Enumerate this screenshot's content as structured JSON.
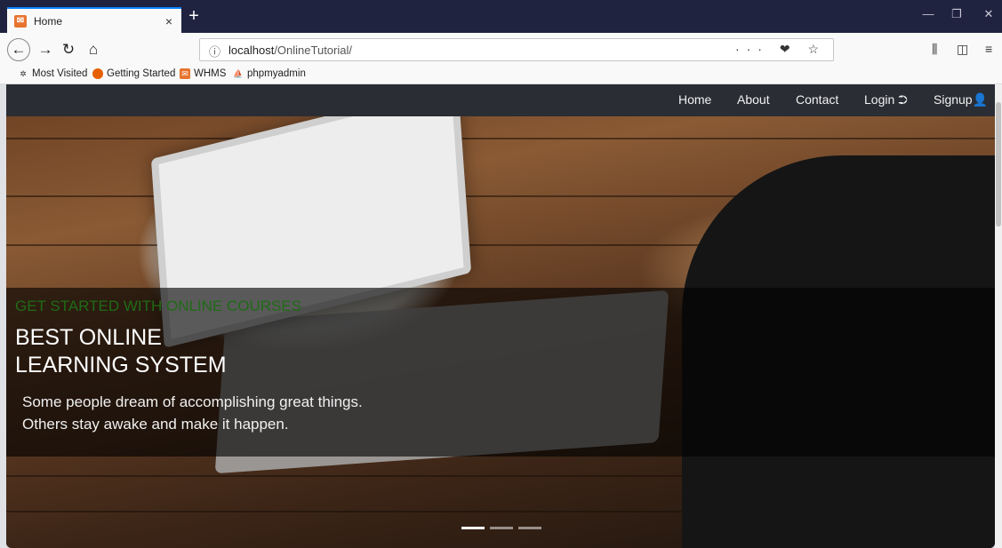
{
  "browser": {
    "tab_title": "Home",
    "tab_close": "×",
    "new_tab": "+",
    "url_host": "localhost",
    "url_path": "/OnlineTutorial/",
    "url_actions": "··· ❤ ☆",
    "bookmarks": [
      {
        "label": "Most Visited",
        "icon": "gear-icon"
      },
      {
        "label": "Getting Started",
        "icon": "firefox-icon"
      },
      {
        "label": "WHMS",
        "icon": "whms-icon"
      },
      {
        "label": "phpmyadmin",
        "icon": "phpmyadmin-icon"
      }
    ]
  },
  "nav": {
    "home": "Home",
    "about": "About",
    "contact": "Contact",
    "login": "Login ⮊",
    "signup": "Signup👤"
  },
  "hero": {
    "tagline": "GET STARTED WITH ONLINE COURSES",
    "headline_1": "BEST ONLINE",
    "headline_2": "LEARNING SYSTEM",
    "sub_1": "Some people dream of accomplishing great things.",
    "sub_2": "Others stay awake and make it happen."
  },
  "carousel": {
    "slide_count": 3,
    "active_index": 0
  },
  "colors": {
    "browser_tab_bar": "#202340",
    "tagline": "#1f6b16",
    "site_nav": "#2a2d33"
  }
}
